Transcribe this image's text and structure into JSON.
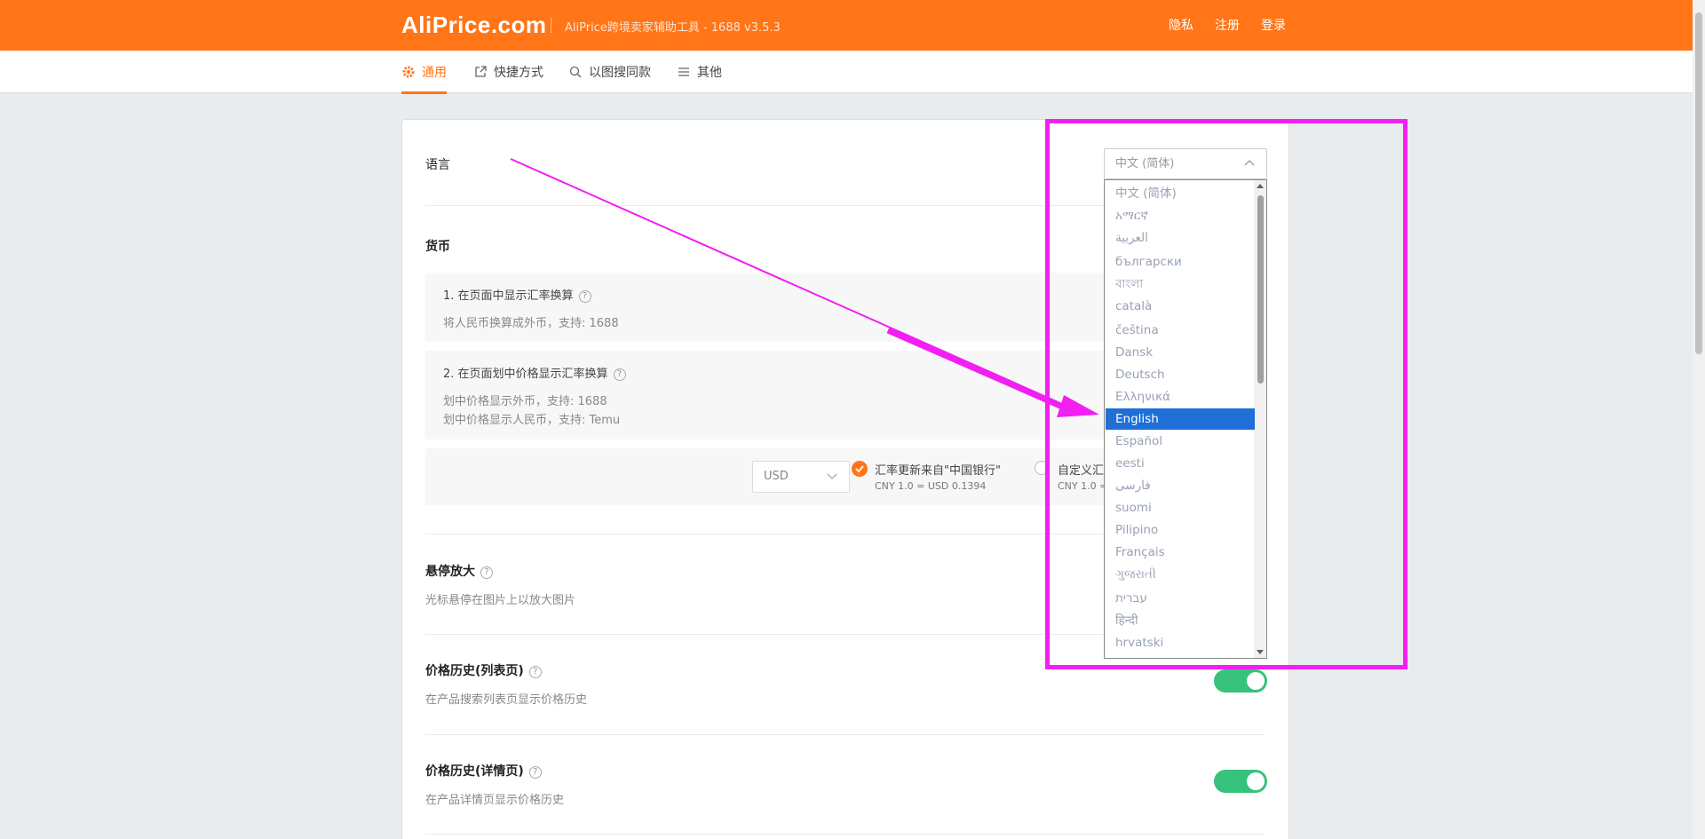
{
  "header": {
    "logo": "AliPrice.com",
    "subtitle": "AliPrice跨境卖家辅助工具 - 1688 v3.5.3",
    "links": [
      "隐私",
      "注册",
      "登录"
    ]
  },
  "tabs": [
    {
      "label": "通用",
      "icon": "gear-icon"
    },
    {
      "label": "快捷方式",
      "icon": "external-link-icon"
    },
    {
      "label": "以图搜同款",
      "icon": "search-icon"
    },
    {
      "label": "其他",
      "icon": "menu-icon"
    }
  ],
  "language": {
    "title": "语言",
    "selected": "中文 (简体)",
    "options": [
      "中文 (简体)",
      "አማርኛ",
      "العربية",
      "български",
      "বাংলা",
      "català",
      "čeština",
      "Dansk",
      "Deutsch",
      "Ελληνικά",
      "English",
      "Español",
      "eesti",
      "فارسی",
      "suomi",
      "Pilipino",
      "Français",
      "ગુજરાતી",
      "עברית",
      "हिन्दी",
      "hrvatski"
    ],
    "highlighted": "English"
  },
  "currency": {
    "title": "货币",
    "item1_title": "1. 在页面中显示汇率换算",
    "item1_desc": "将人民币换算成外币，支持: 1688",
    "item2_title": "2. 在页面划中价格显示汇率换算",
    "item2_desc1": "划中价格显示外币，支持: 1688",
    "item2_desc2": "划中价格显示人民币，支持: Temu",
    "select_value": "USD",
    "rate_source_label": "汇率更新来自\"中国银行\"",
    "rate_value": "CNY 1.0 = USD 0.1394",
    "custom_label": "自定义汇",
    "custom_rate": "CNY 1.0 ="
  },
  "hover_zoom": {
    "title": "悬停放大",
    "desc": "光标悬停在图片上以放大图片"
  },
  "price_history_list": {
    "title": "价格历史(列表页)",
    "desc": "在产品搜索列表页显示价格历史"
  },
  "price_history_detail": {
    "title": "价格历史(详情页)",
    "desc": "在产品详情页显示价格历史"
  },
  "colors": {
    "brand": "#ff7518",
    "toggle_on": "#36c27a",
    "highlight": "#f21ff2",
    "selected": "#1f6fd6"
  }
}
